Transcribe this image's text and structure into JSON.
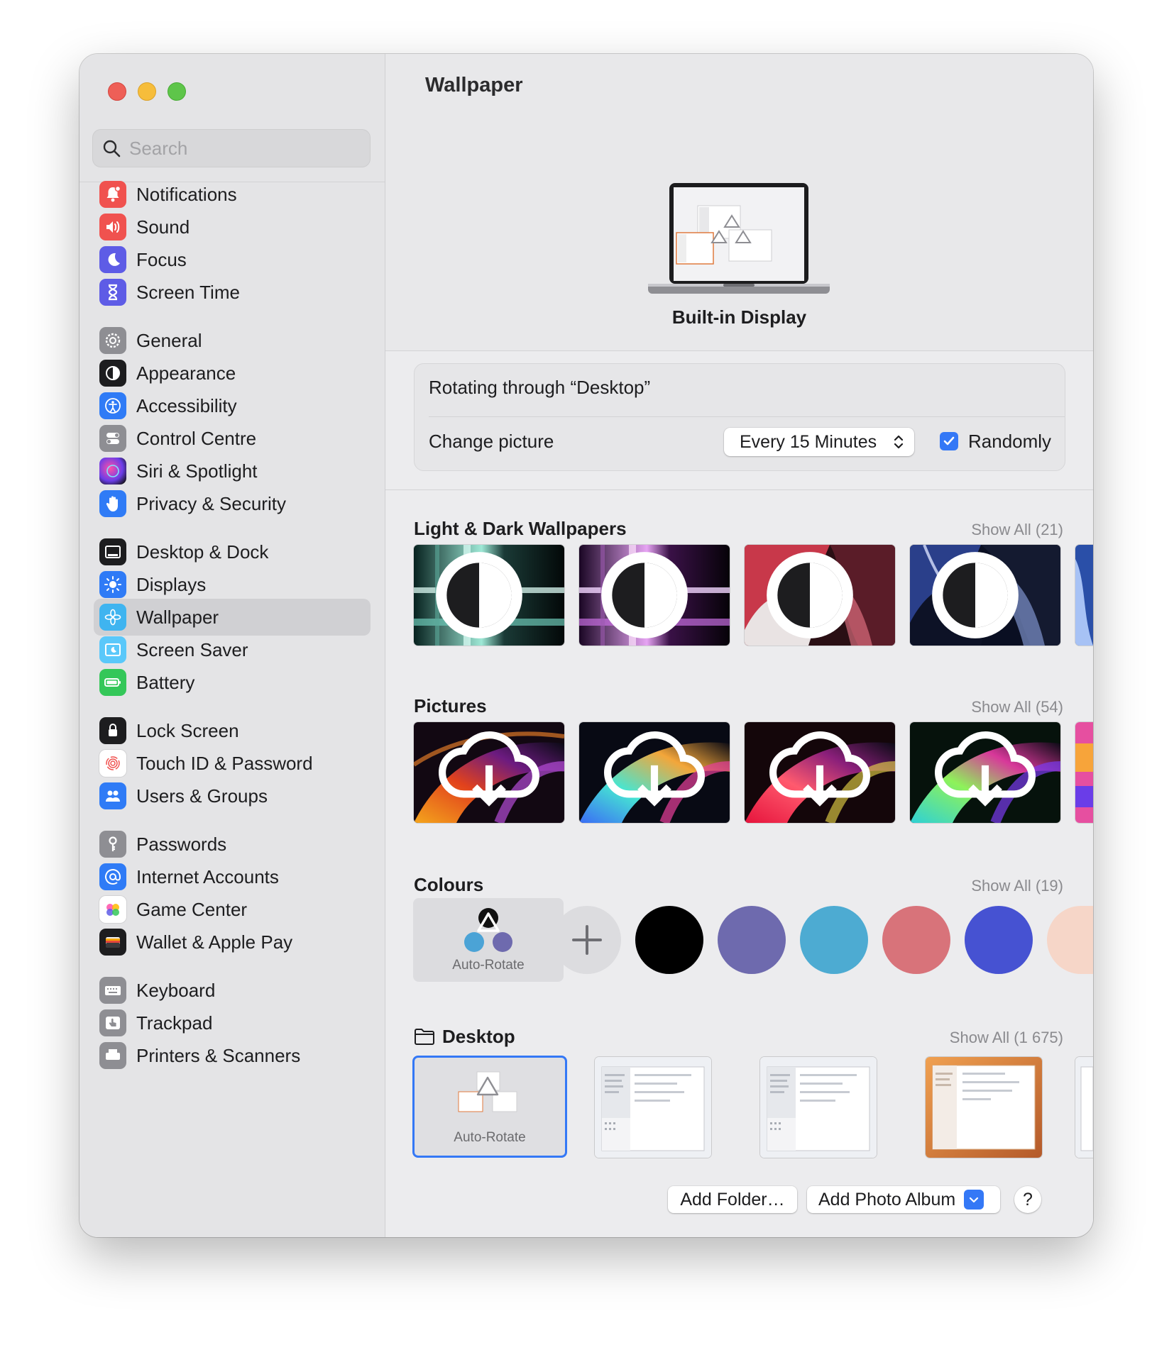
{
  "sidebar": {
    "search_placeholder": "Search",
    "items": [
      {
        "label": "Notifications",
        "icon": "bell-icon",
        "color": "#f0524f"
      },
      {
        "label": "Sound",
        "icon": "speaker-icon",
        "color": "#f0524f"
      },
      {
        "label": "Focus",
        "icon": "moon-icon",
        "color": "#5e5ce6"
      },
      {
        "label": "Screen Time",
        "icon": "hourglass-icon",
        "color": "#5e5ce6"
      },
      {
        "label": "General",
        "icon": "gear-icon",
        "color": "#8e8e93"
      },
      {
        "label": "Appearance",
        "icon": "appearance-icon",
        "color": "#1d1d1f"
      },
      {
        "label": "Accessibility",
        "icon": "accessibility-icon",
        "color": "#2f7bf6"
      },
      {
        "label": "Control Centre",
        "icon": "toggles-icon",
        "color": "#8e8e93"
      },
      {
        "label": "Siri & Spotlight",
        "icon": "siri-icon",
        "color": "#c23ac9"
      },
      {
        "label": "Privacy & Security",
        "icon": "hand-icon",
        "color": "#2f7bf6"
      },
      {
        "label": "Desktop & Dock",
        "icon": "dock-icon",
        "color": "#1d1d1f"
      },
      {
        "label": "Displays",
        "icon": "sun-icon",
        "color": "#2f7bf6"
      },
      {
        "label": "Wallpaper",
        "icon": "flower-icon",
        "color": "#3fb4f0"
      },
      {
        "label": "Screen Saver",
        "icon": "screensaver-icon",
        "color": "#5ac8fa"
      },
      {
        "label": "Battery",
        "icon": "battery-icon",
        "color": "#34c759"
      },
      {
        "label": "Lock Screen",
        "icon": "lock-icon",
        "color": "#1d1d1f"
      },
      {
        "label": "Touch ID & Password",
        "icon": "fingerprint-icon",
        "color": "#ffffff"
      },
      {
        "label": "Users & Groups",
        "icon": "users-icon",
        "color": "#2f7bf6"
      },
      {
        "label": "Passwords",
        "icon": "key-icon",
        "color": "#8e8e93"
      },
      {
        "label": "Internet Accounts",
        "icon": "at-icon",
        "color": "#2f7bf6"
      },
      {
        "label": "Game Center",
        "icon": "gamecenter-icon",
        "color": "#ffffff"
      },
      {
        "label": "Wallet & Apple Pay",
        "icon": "wallet-icon",
        "color": "#1d1d1f"
      },
      {
        "label": "Keyboard",
        "icon": "keyboard-icon",
        "color": "#8e8e93"
      },
      {
        "label": "Trackpad",
        "icon": "trackpad-icon",
        "color": "#8e8e93"
      },
      {
        "label": "Printers & Scanners",
        "icon": "printer-icon",
        "color": "#8e8e93"
      }
    ],
    "active": "Wallpaper"
  },
  "main": {
    "title": "Wallpaper",
    "display_name": "Built-in Display",
    "rotating_text": "Rotating through “Desktop”",
    "change_picture_label": "Change picture",
    "change_picture_value": "Every 15 Minutes",
    "randomly_label": "Randomly",
    "randomly_checked": true,
    "sections": {
      "light_dark": {
        "title": "Light & Dark Wallpapers",
        "show_all": "Show All (21)"
      },
      "pictures": {
        "title": "Pictures",
        "show_all": "Show All (54)"
      },
      "colours": {
        "title": "Colours",
        "show_all": "Show All (19)",
        "auto_rotate": "Auto-Rotate"
      },
      "desktop": {
        "title": "Desktop",
        "show_all": "Show All (1 675)",
        "auto_rotate": "Auto-Rotate"
      }
    },
    "colour_swatches": [
      "#000000",
      "#6e6aae",
      "#4dabd2",
      "#d8737a",
      "#4652d2"
    ],
    "buttons": {
      "add_folder": "Add Folder…",
      "add_photo_album": "Add Photo Album",
      "help": "?"
    }
  }
}
